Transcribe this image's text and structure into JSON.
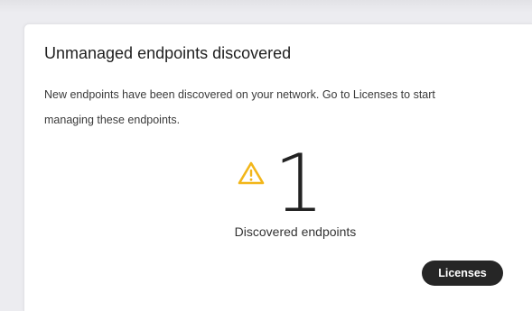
{
  "card": {
    "title": "Unmanaged endpoints discovered",
    "description": "New endpoints have been discovered on your network. Go to Licenses to start managing these endpoints.",
    "count": "1",
    "count_label": "Discovered endpoints",
    "button_label": "Licenses",
    "icon": "warning-icon"
  },
  "colors": {
    "warning": "#f2b619",
    "button_bg": "#262626",
    "button_text": "#ffffff",
    "background": "#ececf0",
    "card": "#ffffff"
  }
}
